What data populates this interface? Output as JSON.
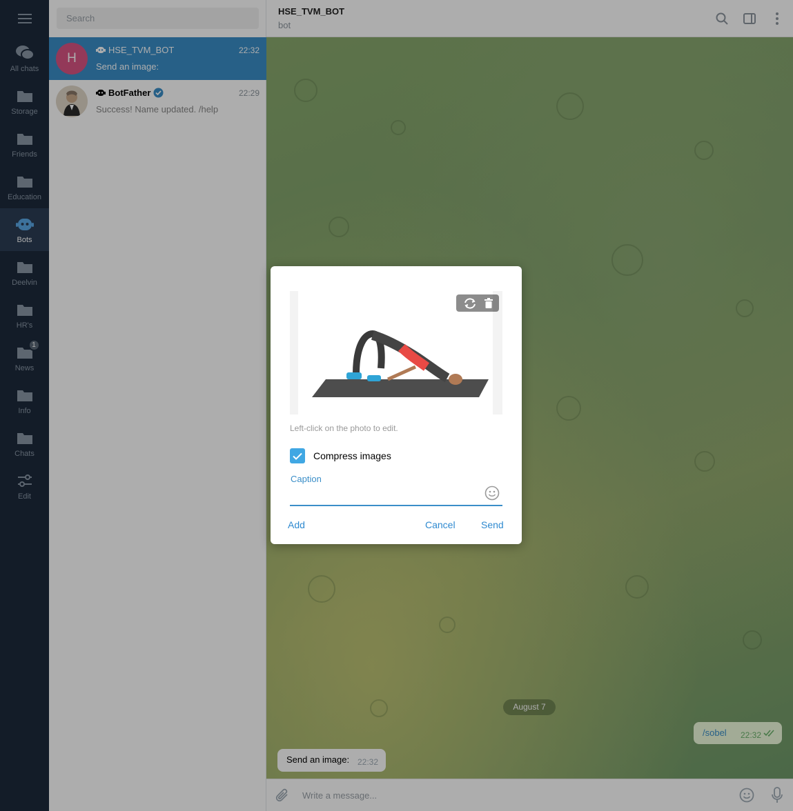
{
  "folders": [
    {
      "label": "All chats"
    },
    {
      "label": "Storage"
    },
    {
      "label": "Friends"
    },
    {
      "label": "Education"
    },
    {
      "label": "Bots"
    },
    {
      "label": "Deelvin"
    },
    {
      "label": "HR's"
    },
    {
      "label": "News",
      "badge": "1"
    },
    {
      "label": "Info"
    },
    {
      "label": "Chats"
    },
    {
      "label": "Edit"
    }
  ],
  "search": {
    "placeholder": "Search"
  },
  "chats": [
    {
      "name": "HSE_TVM_BOT",
      "time": "22:32",
      "preview": "Send an image:",
      "avatar_letter": "H",
      "avatar_color": "#d95483"
    },
    {
      "name": "BotFather",
      "time": "22:29",
      "preview": "Success! Name updated. /help"
    }
  ],
  "header": {
    "title": "HSE_TVM_BOT",
    "subtitle": "bot"
  },
  "messages": {
    "date": "August 7",
    "outgoing": {
      "text": "/sobel",
      "time": "22:32"
    },
    "incoming": {
      "text": "Send an image:",
      "time": "22:32"
    }
  },
  "composer": {
    "placeholder": "Write a message..."
  },
  "dialog": {
    "hint": "Left-click on the photo to edit.",
    "compress_label": "Compress images",
    "compress_checked": true,
    "caption_label": "Caption",
    "add": "Add",
    "cancel": "Cancel",
    "send": "Send"
  },
  "colors": {
    "accent": "#3a8ec8",
    "sidebar": "#1c2a3c",
    "checkbox": "#40a7e3"
  }
}
